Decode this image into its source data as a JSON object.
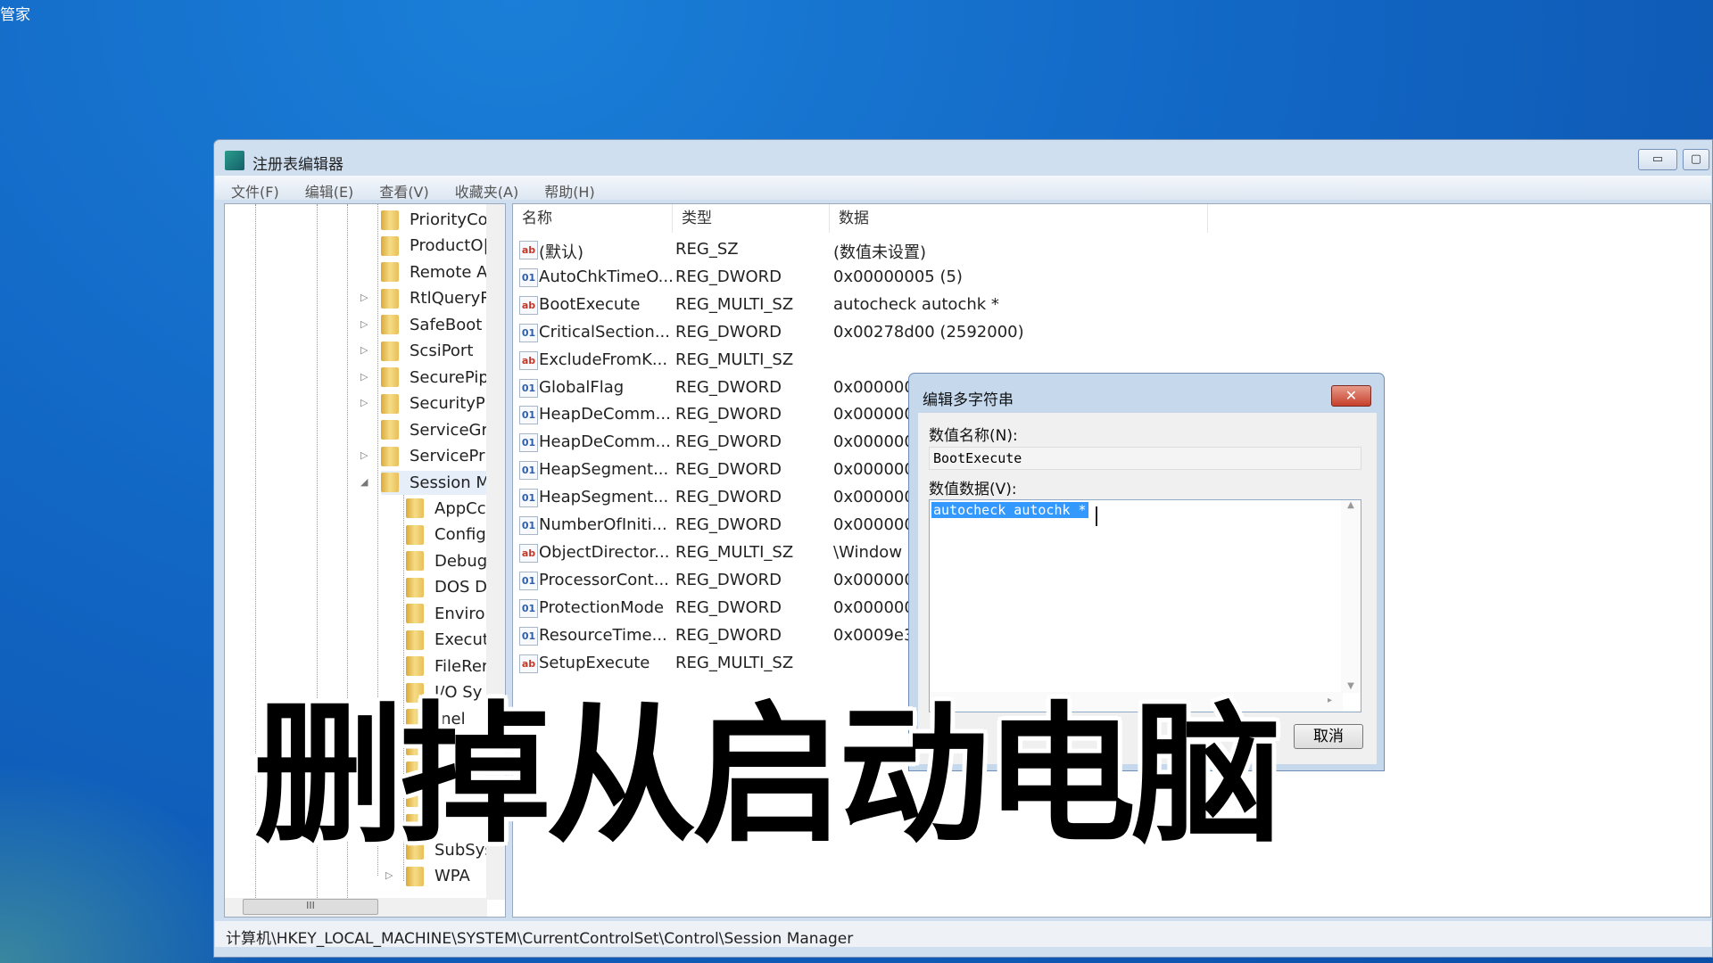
{
  "desktop": {
    "corner_text": "管家"
  },
  "window": {
    "title": "注册表编辑器",
    "minimize": "▭",
    "maximize": "▢"
  },
  "menu": [
    "文件(F)",
    "编辑(E)",
    "查看(V)",
    "收藏夹(A)",
    "帮助(H)"
  ],
  "tree": {
    "items": [
      {
        "label": "PriorityCo",
        "level": 0,
        "expander": ""
      },
      {
        "label": "ProductO|",
        "level": 0,
        "expander": ""
      },
      {
        "label": "Remote A",
        "level": 0,
        "expander": ""
      },
      {
        "label": "RtlQueryR",
        "level": 0,
        "expander": "▷"
      },
      {
        "label": "SafeBoot",
        "level": 0,
        "expander": "▷"
      },
      {
        "label": "ScsiPort",
        "level": 0,
        "expander": "▷"
      },
      {
        "label": "SecurePip",
        "level": 0,
        "expander": "▷"
      },
      {
        "label": "SecurityPr",
        "level": 0,
        "expander": "▷"
      },
      {
        "label": "ServiceGr",
        "level": 0,
        "expander": ""
      },
      {
        "label": "ServicePr",
        "level": 0,
        "expander": "▷"
      },
      {
        "label": "Session M",
        "level": 0,
        "expander": "◢",
        "selected": true
      },
      {
        "label": "AppCc",
        "level": 1,
        "expander": ""
      },
      {
        "label": "Config",
        "level": 1,
        "expander": ""
      },
      {
        "label": "Debug",
        "level": 1,
        "expander": ""
      },
      {
        "label": "DOS D",
        "level": 1,
        "expander": ""
      },
      {
        "label": "Enviro",
        "level": 1,
        "expander": ""
      },
      {
        "label": "Execut",
        "level": 1,
        "expander": ""
      },
      {
        "label": "FileRer",
        "level": 1,
        "expander": ""
      },
      {
        "label": "I/O Sy",
        "level": 1,
        "expander": ""
      },
      {
        "label": "rnel",
        "level": 1,
        "expander": ""
      },
      {
        "label": "",
        "level": 1,
        "expander": ""
      },
      {
        "label": "",
        "level": 1,
        "expander": ""
      },
      {
        "label": "",
        "level": 1,
        "expander": ""
      },
      {
        "label": "",
        "level": 1,
        "expander": ""
      },
      {
        "label": "SubSys",
        "level": 1,
        "expander": ""
      },
      {
        "label": "WPA",
        "level": 1,
        "expander": "▷"
      }
    ],
    "hscroll_grip": "III"
  },
  "list": {
    "headers": [
      "名称",
      "类型",
      "数据"
    ],
    "rows": [
      {
        "icon": "ab",
        "name": "(默认)",
        "type": "REG_SZ",
        "data": "(数值未设置)"
      },
      {
        "icon": "bin",
        "name": "AutoChkTimeO...",
        "type": "REG_DWORD",
        "data": "0x00000005 (5)"
      },
      {
        "icon": "ab",
        "name": "BootExecute",
        "type": "REG_MULTI_SZ",
        "data": "autocheck autochk *"
      },
      {
        "icon": "bin",
        "name": "CriticalSection...",
        "type": "REG_DWORD",
        "data": "0x00278d00 (2592000)"
      },
      {
        "icon": "ab",
        "name": "ExcludeFromK...",
        "type": "REG_MULTI_SZ",
        "data": ""
      },
      {
        "icon": "bin",
        "name": "GlobalFlag",
        "type": "REG_DWORD",
        "data": "0x000000"
      },
      {
        "icon": "bin",
        "name": "HeapDeComm...",
        "type": "REG_DWORD",
        "data": "0x000000"
      },
      {
        "icon": "bin",
        "name": "HeapDeComm...",
        "type": "REG_DWORD",
        "data": "0x000000"
      },
      {
        "icon": "bin",
        "name": "HeapSegment...",
        "type": "REG_DWORD",
        "data": "0x000000"
      },
      {
        "icon": "bin",
        "name": "HeapSegment...",
        "type": "REG_DWORD",
        "data": "0x000000"
      },
      {
        "icon": "bin",
        "name": "NumberOfIniti...",
        "type": "REG_DWORD",
        "data": "0x000000"
      },
      {
        "icon": "ab",
        "name": "ObjectDirector...",
        "type": "REG_MULTI_SZ",
        "data": "\\Window"
      },
      {
        "icon": "bin",
        "name": "ProcessorCont...",
        "type": "REG_DWORD",
        "data": "0x000000"
      },
      {
        "icon": "bin",
        "name": "ProtectionMode",
        "type": "REG_DWORD",
        "data": "0x000000"
      },
      {
        "icon": "bin",
        "name": "ResourceTime...",
        "type": "REG_DWORD",
        "data": "0x0009e3"
      },
      {
        "icon": "ab",
        "name": "SetupExecute",
        "type": "REG_MULTI_SZ",
        "data": ""
      }
    ]
  },
  "status": "计算机\\HKEY_LOCAL_MACHINE\\SYSTEM\\CurrentControlSet\\Control\\Session Manager",
  "dialog": {
    "title": "编辑多字符串",
    "close": "✕",
    "name_label": "数值名称(N):",
    "name_value": "BootExecute",
    "data_label": "数值数据(V):",
    "data_value": "autocheck autochk *",
    "cancel": "取消"
  },
  "caption": "删掉从启动电脑"
}
